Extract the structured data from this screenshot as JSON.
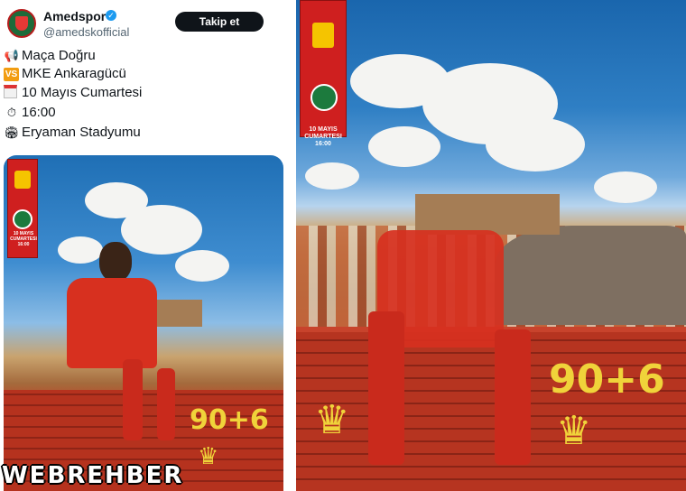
{
  "tweet": {
    "account_name": "Amedspor",
    "handle": "@amedskofficial",
    "follow_label": "Takip et",
    "lines": [
      {
        "icon": "megaphone-icon",
        "text": "Maça Doğru"
      },
      {
        "icon": "vs-icon",
        "text": "MKE Ankaragücü"
      },
      {
        "icon": "calendar-icon",
        "text": "10 Mayıs Cumartesi"
      },
      {
        "icon": "stopwatch-icon",
        "text": "16:00"
      },
      {
        "icon": "stadium-icon",
        "text": "Eryaman Stadyumu"
      }
    ],
    "vs_badge": "VS"
  },
  "poster": {
    "date_line1": "10 MAYIS",
    "date_line2": "CUMARTESI",
    "time": "16:00",
    "graffiti": "90+6"
  },
  "watermark": "WEBREHBER",
  "colors": {
    "follow_bg": "#0f1419",
    "verified": "#1d9bf0",
    "jersey_red": "#d7301f",
    "graffiti_yellow": "#f0d33a"
  }
}
